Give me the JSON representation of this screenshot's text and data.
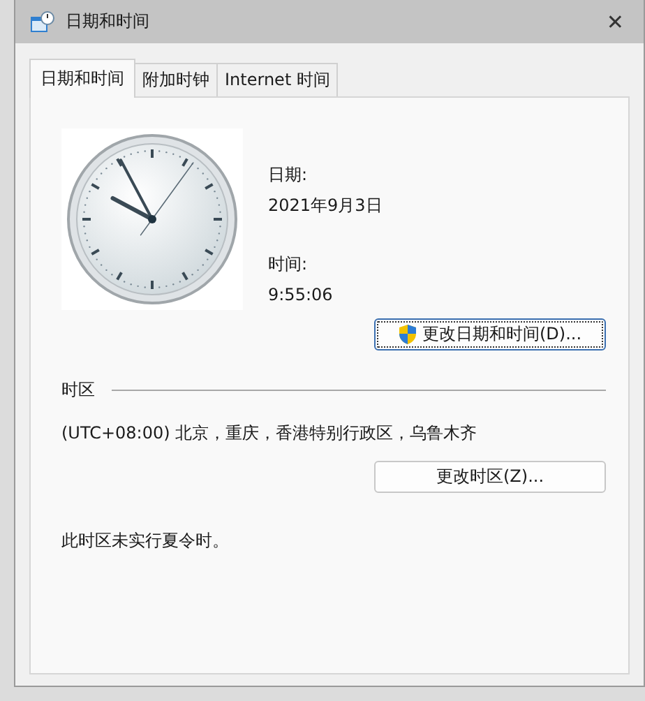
{
  "window": {
    "title": "日期和时间",
    "close": "✕"
  },
  "tabs": [
    {
      "label": "日期和时间",
      "selected": true
    },
    {
      "label": "附加时钟",
      "selected": false
    },
    {
      "label": "Internet 时间",
      "selected": false
    }
  ],
  "date": {
    "label": "日期:",
    "value": "2021年9月3日"
  },
  "time": {
    "label": "时间:",
    "value": "9:55:06"
  },
  "change_datetime_button": "更改日期和时间(D)...",
  "timezone": {
    "heading": "时区",
    "value": "(UTC+08:00) 北京，重庆，香港特别行政区，乌鲁木齐",
    "button": "更改时区(Z)...",
    "note": "此时区未实行夏令时。"
  }
}
